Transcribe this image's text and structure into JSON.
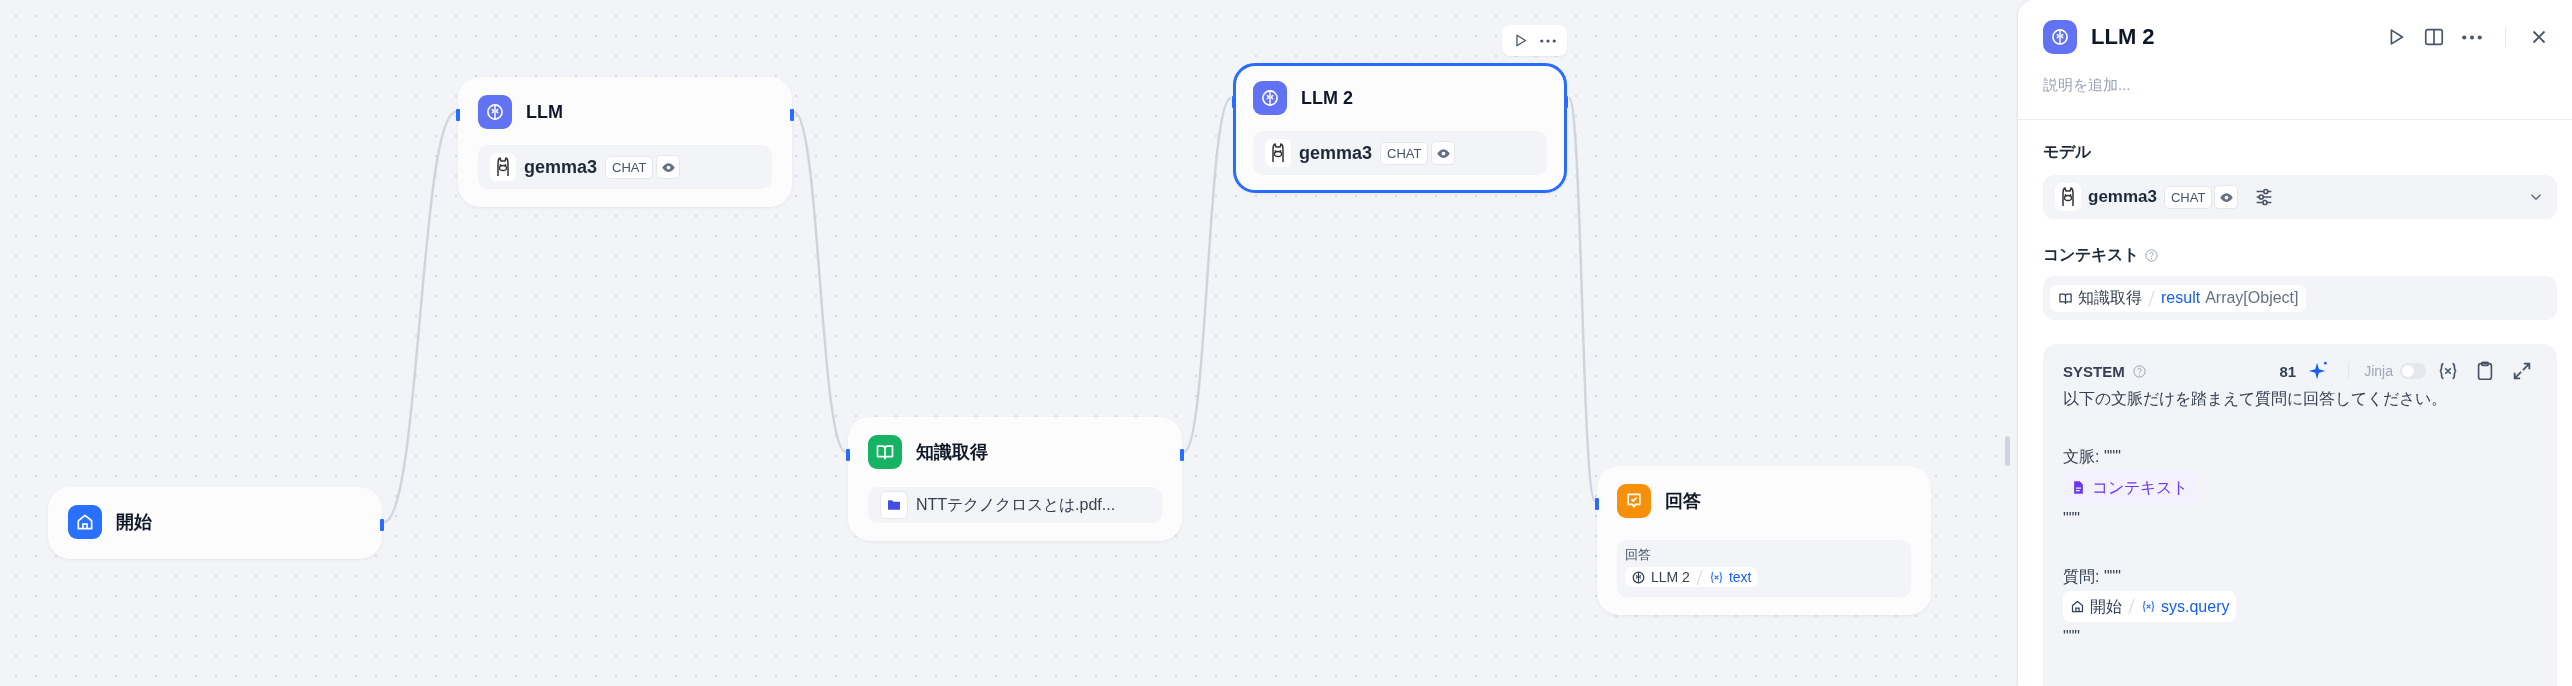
{
  "canvas": {
    "nodes": [
      {
        "kind": "start",
        "title": "開始",
        "selected": false
      },
      {
        "kind": "llm",
        "title": "LLM",
        "selected": false,
        "model": {
          "name": "gemma3",
          "mode": "CHAT"
        }
      },
      {
        "kind": "knowledge",
        "title": "知識取得",
        "selected": false,
        "file": "NTTテクノクロスとは.pdf..."
      },
      {
        "kind": "llm",
        "title": "LLM 2",
        "selected": true,
        "model": {
          "name": "gemma3",
          "mode": "CHAT"
        }
      },
      {
        "kind": "answer",
        "title": "回答",
        "selected": false,
        "field_label": "回答",
        "ref": {
          "kind": "llm",
          "node": "LLM 2",
          "var": "text"
        }
      }
    ]
  },
  "panel": {
    "title": "LLM 2",
    "description_placeholder": "説明を追加...",
    "model_label": "モデル",
    "model": {
      "name": "gemma3",
      "mode": "CHAT"
    },
    "context_label": "コンテキスト",
    "context": {
      "node": "知識取得",
      "var": "result",
      "type": "Array[Object]"
    },
    "system": {
      "label": "SYSTEM",
      "count": "81",
      "jinja": {
        "label": "Jinja",
        "on": false,
        "disabled": true
      },
      "lines": [
        {
          "kind": "text",
          "text": "以下の文脈だけを踏まえて質問に回答してください。"
        },
        {
          "kind": "blank"
        },
        {
          "kind": "text",
          "text": "文脈: \"\"\""
        },
        {
          "kind": "context_ref",
          "text": "コンテキスト"
        },
        {
          "kind": "text",
          "text": "\"\"\""
        },
        {
          "kind": "blank"
        },
        {
          "kind": "text",
          "text": "質問: \"\"\""
        },
        {
          "kind": "var_ref",
          "ref": {
            "kind": "start",
            "node": "開始",
            "var": "sys.query"
          }
        },
        {
          "kind": "text",
          "text": "\"\"\""
        }
      ]
    }
  }
}
